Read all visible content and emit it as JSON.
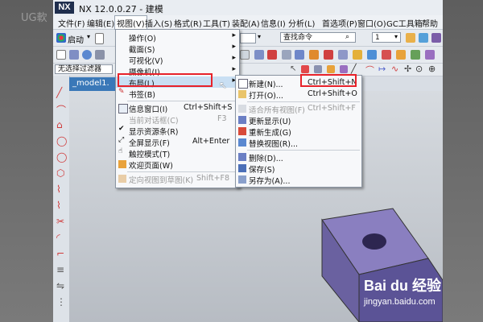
{
  "background": {
    "left_text": "UG軟"
  },
  "window": {
    "logo": "NX",
    "title": "NX 12.0.0.27 - 建模"
  },
  "menubar": [
    "文件(F)",
    "编辑(E)",
    "视图(V)",
    "插入(S)",
    "格式(R)",
    "工具(T)",
    "装配(A)",
    "信息(I)",
    "分析(L)",
    "首选项(P)",
    "窗口(O)",
    "GC工具箱",
    "帮助"
  ],
  "toolbar": {
    "start_label": "启动",
    "search_command": "查找命令",
    "qty_value": "1",
    "filter_label": "无选择过滤器"
  },
  "tab": {
    "label": "_model1."
  },
  "view_menu": {
    "items": [
      {
        "label": "操作(O)",
        "arrow": true
      },
      {
        "label": "截面(S)",
        "arrow": true
      },
      {
        "label": "可视化(V)",
        "arrow": true
      },
      {
        "label": "摄像机(I)",
        "arrow": true
      },
      {
        "label": "布局(L)",
        "arrow": true,
        "highlighted": true
      },
      {
        "label": "书签(B)"
      },
      {
        "label": "信息窗口(I)",
        "shortcut": "Ctrl+Shift+S"
      },
      {
        "label": "当前对话框(C)",
        "shortcut": "F3",
        "disabled": true
      },
      {
        "label": "显示资源条(R)"
      },
      {
        "label": "全屏显示(F)",
        "shortcut": "Alt+Enter"
      },
      {
        "label": "触控模式(T)"
      },
      {
        "label": "欢迎页面(W)"
      },
      {
        "label": "定向视图到草图(K)",
        "shortcut": "Shift+F8",
        "disabled": true
      }
    ]
  },
  "layout_menu": {
    "items": [
      {
        "label": "新建(N)...",
        "shortcut": "Ctrl+Shift+N"
      },
      {
        "label": "打开(O)...",
        "shortcut": "Ctrl+Shift+O"
      },
      {
        "label": "适合所有视图(F)",
        "shortcut": "Ctrl+Shift+F",
        "disabled": true
      },
      {
        "label": "更新显示(U)"
      },
      {
        "label": "重新生成(G)"
      },
      {
        "label": "替换视图(R)..."
      },
      {
        "label": "删除(D)..."
      },
      {
        "label": "保存(S)"
      },
      {
        "label": "另存为(A)..."
      }
    ]
  },
  "watermark": {
    "brand": "Bai du 经验",
    "url": "jingyan.baidu.com"
  },
  "colors": {
    "highlight_box": "#e8222a",
    "model_face": "#8a7fc0"
  }
}
